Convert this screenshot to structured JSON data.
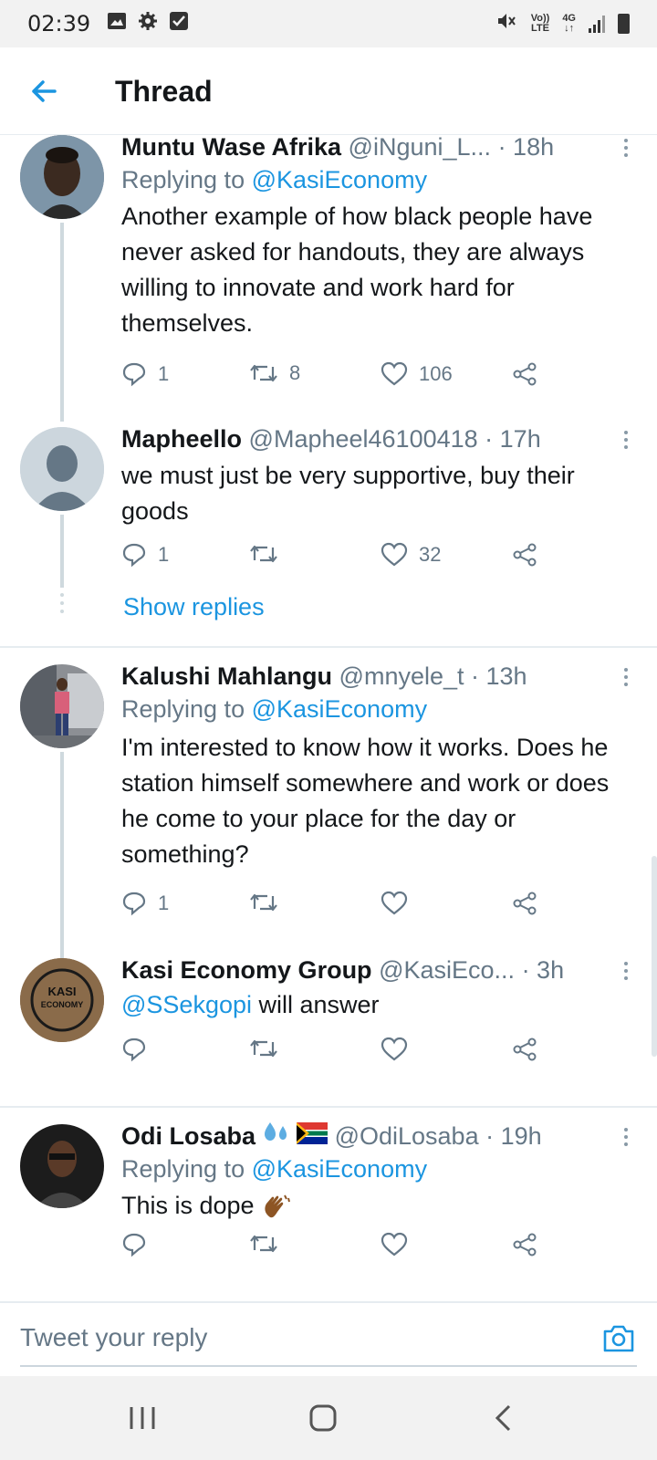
{
  "status_bar": {
    "time": "02:39",
    "net_top": "Vo))",
    "net_bottom": "LTE",
    "net2_top": "4G",
    "net2_bottom": "↓↑"
  },
  "header": {
    "title": "Thread"
  },
  "tweets": [
    {
      "name": "Muntu Wase Afrika",
      "handle": "@iNguni_L...",
      "time": "· 18h",
      "replying_prefix": "Replying to ",
      "replying_to": "@KasiEconomy",
      "text": "Another example of how black people have never asked for handouts, they are always willing to innovate and work hard for themselves.",
      "replies": "1",
      "retweets": "8",
      "likes": "106"
    },
    {
      "name": "Mapheello",
      "handle": "@Mapheel46100418",
      "time": "· 17h",
      "text": "we must just be very supportive, buy their goods",
      "replies": "1",
      "retweets": "",
      "likes": "32"
    },
    {
      "name": "Kalushi Mahlangu",
      "handle": "@mnyele_t",
      "time": "· 13h",
      "replying_prefix": "Replying to ",
      "replying_to": "@KasiEconomy",
      "text": "I'm interested to know how it works. Does he station himself somewhere and work or does he come to your place for the day or something?",
      "replies": "1",
      "retweets": "",
      "likes": ""
    },
    {
      "name": "Kasi Economy Group",
      "handle": "@KasiEco...",
      "time": "· 3h",
      "text_mention": "@SSekgopi",
      "text": " will answer",
      "avatar_line1": "KASI",
      "avatar_line2": "ECONOMY",
      "replies": "",
      "retweets": "",
      "likes": ""
    },
    {
      "name": "Odi Losaba",
      "handle": "@OdiLosaba",
      "time": "· 19h",
      "replying_prefix": "Replying to ",
      "replying_to": "@KasiEconomy",
      "text": "This is dope",
      "replies": "",
      "retweets": "",
      "likes": ""
    }
  ],
  "show_replies": "Show replies",
  "compose": {
    "placeholder": "Tweet your reply"
  },
  "colors": {
    "accent": "#1b95e0",
    "secondary_text": "#657786",
    "primary_text": "#14171a"
  }
}
